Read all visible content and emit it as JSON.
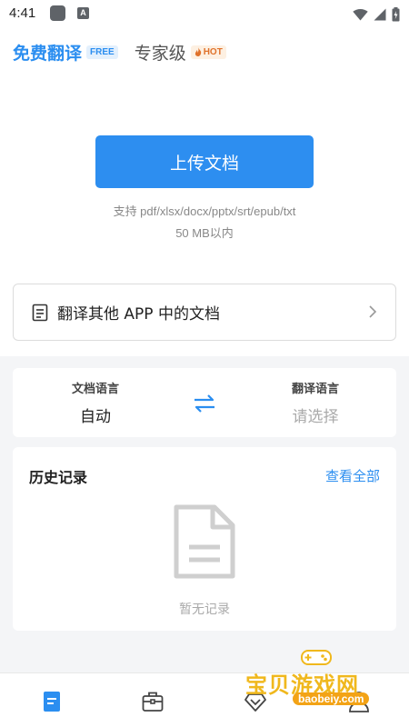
{
  "status_bar": {
    "time": "4:41",
    "notification_letter": "A"
  },
  "tabs": {
    "free_label": "免费翻译",
    "free_badge": "FREE",
    "pro_label": "专家级",
    "pro_badge": "HOT"
  },
  "upload": {
    "button_label": "上传文档",
    "support_text": "支持 pdf/xlsx/docx/pptx/srt/epub/txt",
    "size_text": "50 MB以内"
  },
  "other_app": {
    "label": "翻译其他 APP 中的文档"
  },
  "language": {
    "source_title": "文档语言",
    "source_value": "自动",
    "target_title": "翻译语言",
    "target_value": "请选择"
  },
  "history": {
    "title": "历史记录",
    "view_all": "查看全部",
    "empty_text": "暂无记录"
  },
  "bottom_nav": {
    "items": [
      "document-icon",
      "toolbox-icon",
      "diamond-icon",
      "profile-icon"
    ],
    "active_color": "#2b8ef0"
  },
  "watermark": {
    "title": "宝贝游戏网",
    "url": "baobeiy.com"
  },
  "colors": {
    "accent": "#2b8ef0",
    "hot": "#e0722b"
  }
}
